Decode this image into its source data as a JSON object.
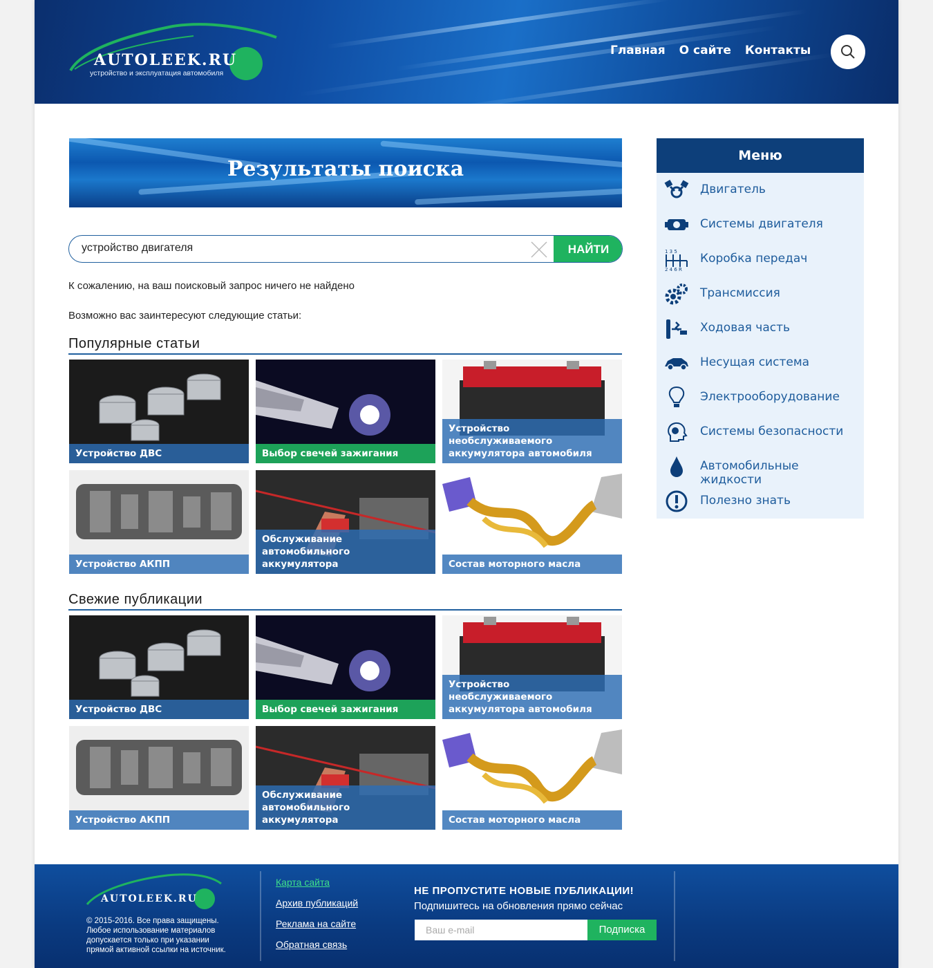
{
  "header": {
    "logo_brand": "AUTOLEEK.RU",
    "logo_tagline": "устройство и эксплуатация автомобиля",
    "nav": [
      "Главная",
      "О сайте",
      "Контакты"
    ]
  },
  "banner": {
    "title": "Результаты поиска"
  },
  "search": {
    "value": "устройство двигателя",
    "button": "НАЙТИ"
  },
  "messages": {
    "not_found": "К сожалению, на ваш поисковый запрос ничего не найдено",
    "suggest": "Возможно вас заинтересуют следующие статьи:"
  },
  "popular": {
    "title": "Популярные статьи",
    "items": [
      {
        "caption": "Устройство ДВС"
      },
      {
        "caption": "Выбор свечей зажигания"
      },
      {
        "caption": "Устройство необслуживаемого аккумулятора автомобиля"
      },
      {
        "caption": "Устройство АКПП"
      },
      {
        "caption": "Обслуживание автомобильного аккумулятора"
      },
      {
        "caption": "Состав моторного масла"
      }
    ]
  },
  "fresh": {
    "title": "Свежие публикации",
    "items": [
      {
        "caption": "Устройство ДВС"
      },
      {
        "caption": "Выбор свечей зажигания"
      },
      {
        "caption": "Устройство необслуживаемого аккумулятора автомобиля"
      },
      {
        "caption": "Устройство АКПП"
      },
      {
        "caption": "Обслуживание автомобильного аккумулятора"
      },
      {
        "caption": "Состав моторного масла"
      }
    ]
  },
  "sidebar": {
    "title": "Меню",
    "items": [
      {
        "label": "Двигатель",
        "icon": "engine-pistons-icon"
      },
      {
        "label": "Системы двигателя",
        "icon": "engine-block-icon"
      },
      {
        "label": "Коробка передач",
        "icon": "gear-shift-icon"
      },
      {
        "label": "Трансмиссия",
        "icon": "gears-icon"
      },
      {
        "label": "Ходовая часть",
        "icon": "suspension-icon"
      },
      {
        "label": "Несущая система",
        "icon": "car-body-icon"
      },
      {
        "label": "Электрооборудование",
        "icon": "light-bulb-icon"
      },
      {
        "label": "Системы безопасности",
        "icon": "safety-head-icon"
      },
      {
        "label": "Автомобильные жидкости",
        "icon": "drop-icon"
      },
      {
        "label": "Полезно знать",
        "icon": "exclamation-icon"
      }
    ]
  },
  "footer": {
    "logo_brand": "AUTOLEEK.RU",
    "copyright": "© 2015-2016. Все права защищены. Любое использование материалов допускается только при указании прямой активной ссылки на источник.",
    "links": [
      "Карта сайта",
      "Архив публикаций",
      "Реклама на сайте",
      "Обратная связь"
    ],
    "subscribe_title": "НЕ ПРОПУСТИТЕ НОВЫЕ ПУБЛИКАЦИИ!",
    "subscribe_text": "Подпишитесь на обновления прямо сейчас",
    "email_placeholder": "Ваш e-mail",
    "subscribe_button": "Подписка"
  },
  "colors": {
    "accent_green": "#1fb35f",
    "brand_blue": "#0d3f7a",
    "link_blue": "#1e5c9c"
  }
}
